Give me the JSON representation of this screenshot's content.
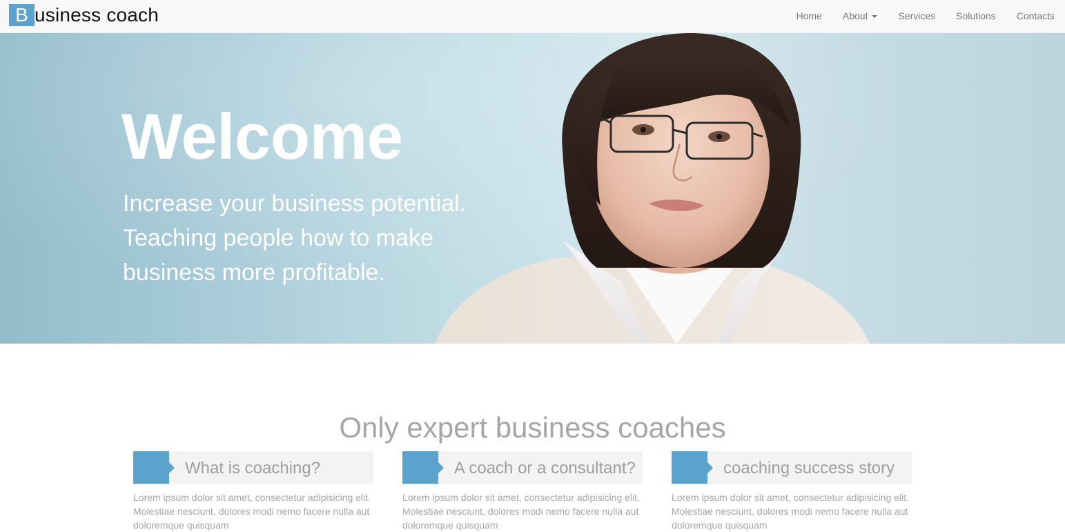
{
  "header": {
    "brand_initial": "B",
    "brand_rest": "usiness coach",
    "nav": [
      {
        "label": "Home"
      },
      {
        "label": "About",
        "has_dropdown": true
      },
      {
        "label": "Services"
      },
      {
        "label": "Solutions"
      },
      {
        "label": "Contacts"
      }
    ]
  },
  "hero": {
    "title": "Welcome",
    "subtitle": "Increase your business potential. Teaching people how to make business more profitable."
  },
  "section": {
    "title": "Only expert business coaches",
    "cards": [
      {
        "title": "What is coaching?",
        "text": "Lorem ipsum dolor sit amet, consectetur adipisicing elit. Molestiae nesciunt, dolores modi nemo facere nulla aut doloremque quisquam"
      },
      {
        "title": "A coach or a consultant?",
        "text": "Lorem ipsum dolor sit amet, consectetur adipisicing elit. Molestiae nesciunt, dolores modi nemo facere nulla aut doloremque quisquam"
      },
      {
        "title": "coaching success story",
        "text": "Lorem ipsum dolor sit amet, consectetur adipisicing elit. Molestiae nesciunt, dolores modi nemo facere nulla aut doloremque quisquam"
      }
    ]
  },
  "colors": {
    "accent": "#5ba3cc",
    "muted_text": "#a6a6a6",
    "nav_text": "#777777",
    "navbar_bg": "#f8f8f8"
  },
  "icons": {
    "about_dropdown": "caret-down-icon"
  }
}
